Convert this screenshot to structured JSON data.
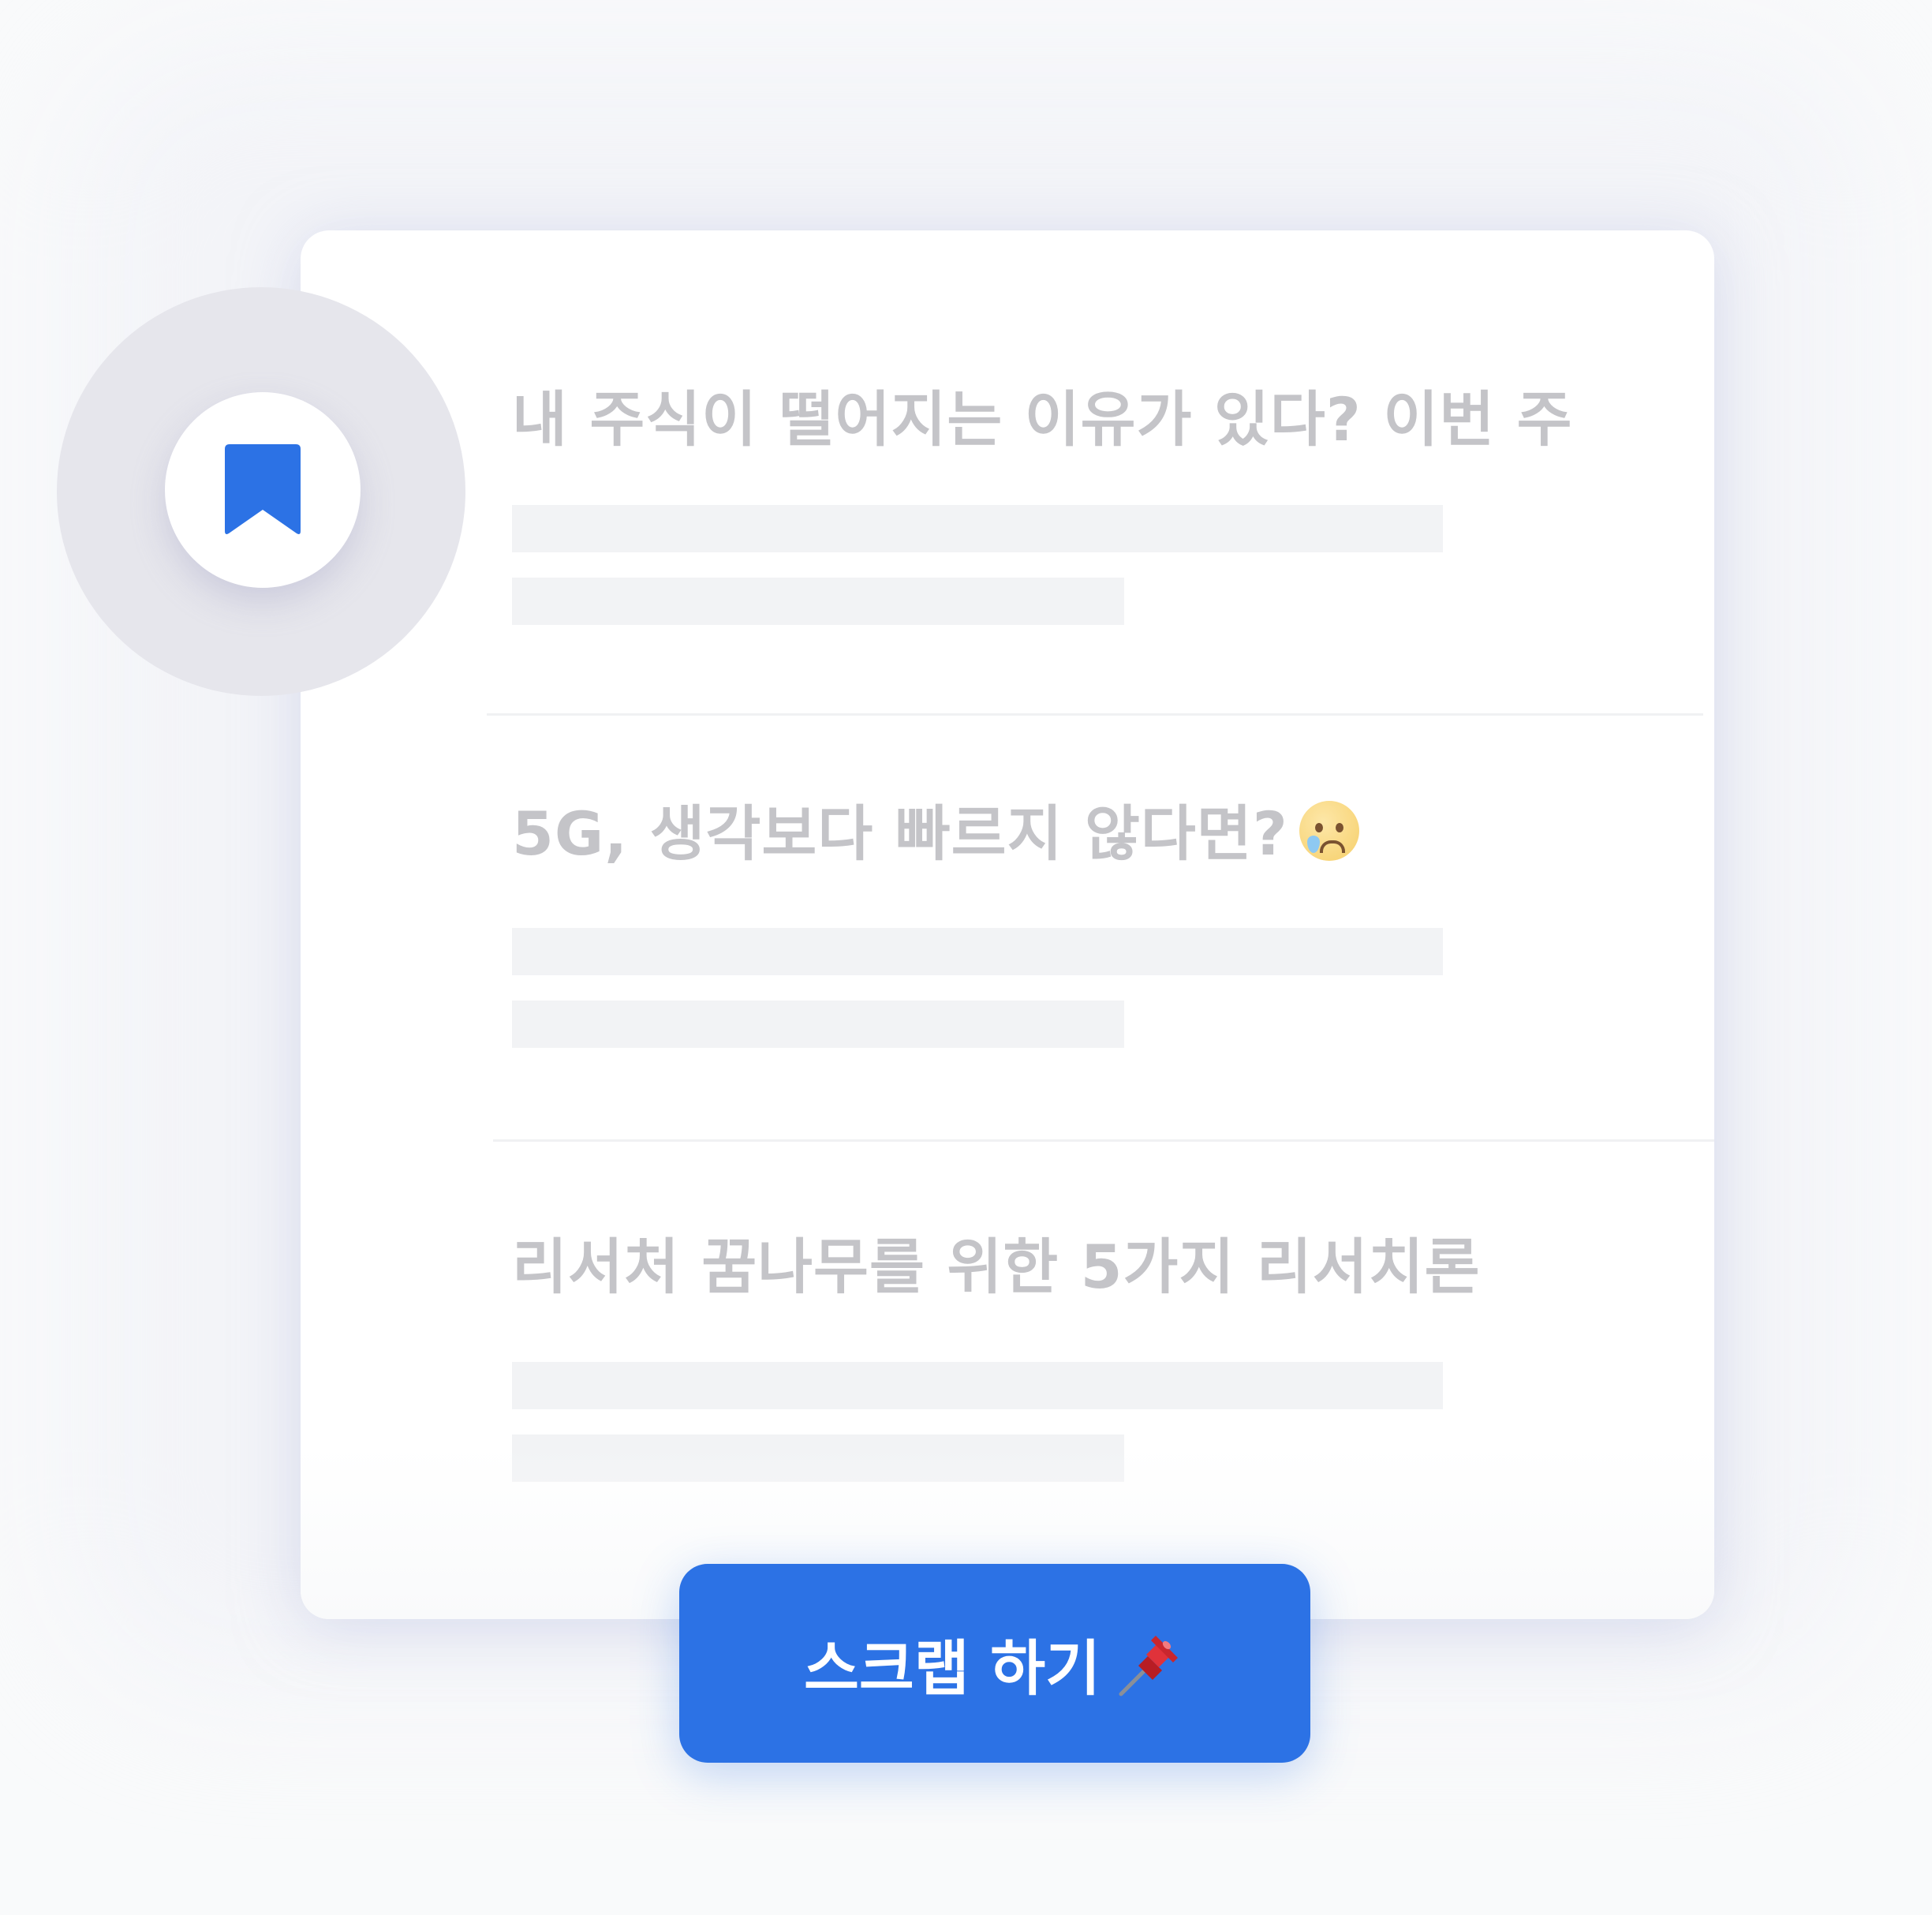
{
  "articles": [
    {
      "title": "내 주식이 떨어지는 이유가 있다? 이번 주"
    },
    {
      "title": "5G, 생각보다 빠르지 않다면?",
      "emoji": "crying-face-icon"
    },
    {
      "title": "리서처 꿈나무를 위한 5가지 리서치론"
    }
  ],
  "scrap_button": {
    "label": "스크랩 하기",
    "icon": "pushpin-icon"
  },
  "bookmark_badge": {
    "icon": "bookmark-icon"
  },
  "colors": {
    "accent": "#2c72e5",
    "title_text": "#c4c4c8",
    "skeleton": "#f2f3f5",
    "badge_ring": "#e6e6ec"
  }
}
